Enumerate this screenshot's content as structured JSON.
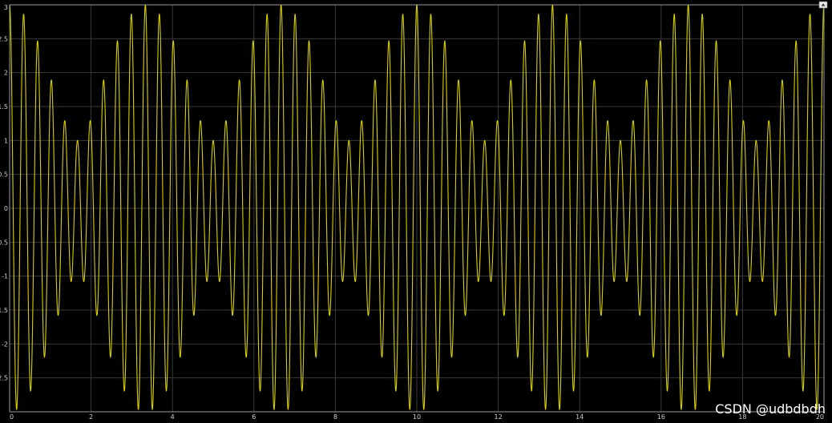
{
  "chart_data": {
    "type": "line",
    "title": "",
    "xlabel": "",
    "ylabel": "",
    "xlim": [
      0,
      20
    ],
    "ylim": [
      -3,
      3
    ],
    "x_ticks": [
      "0",
      "2",
      "4",
      "6",
      "8",
      "10",
      "12",
      "14",
      "16",
      "18",
      "20"
    ],
    "y_ticks": [
      "3",
      "2.5",
      "2",
      "1.5",
      "1",
      "0.5",
      "0",
      "-0.5",
      "-1",
      "-1.5",
      "-2",
      "-2.5"
    ],
    "grid": true,
    "series": [
      {
        "color": "#d8d000",
        "description_of_shape": "sum of two sinusoids beating; carrier ≈ 3 cycles per unit, envelope period ≈ 3.3",
        "components": [
          {
            "amplitude": 2.0,
            "frequency": 3.0
          },
          {
            "amplitude": 1.0,
            "frequency": 2.7
          }
        ],
        "x_start": 0,
        "x_end": 20
      }
    ]
  },
  "colors": {
    "plot_background": "#000000",
    "frame": "#9a9a9a",
    "grid": "#3a3a3a",
    "signal": "#d8d000"
  },
  "watermark": "CSDN @udbdbdh",
  "corner_button_icon": "expand-icon"
}
